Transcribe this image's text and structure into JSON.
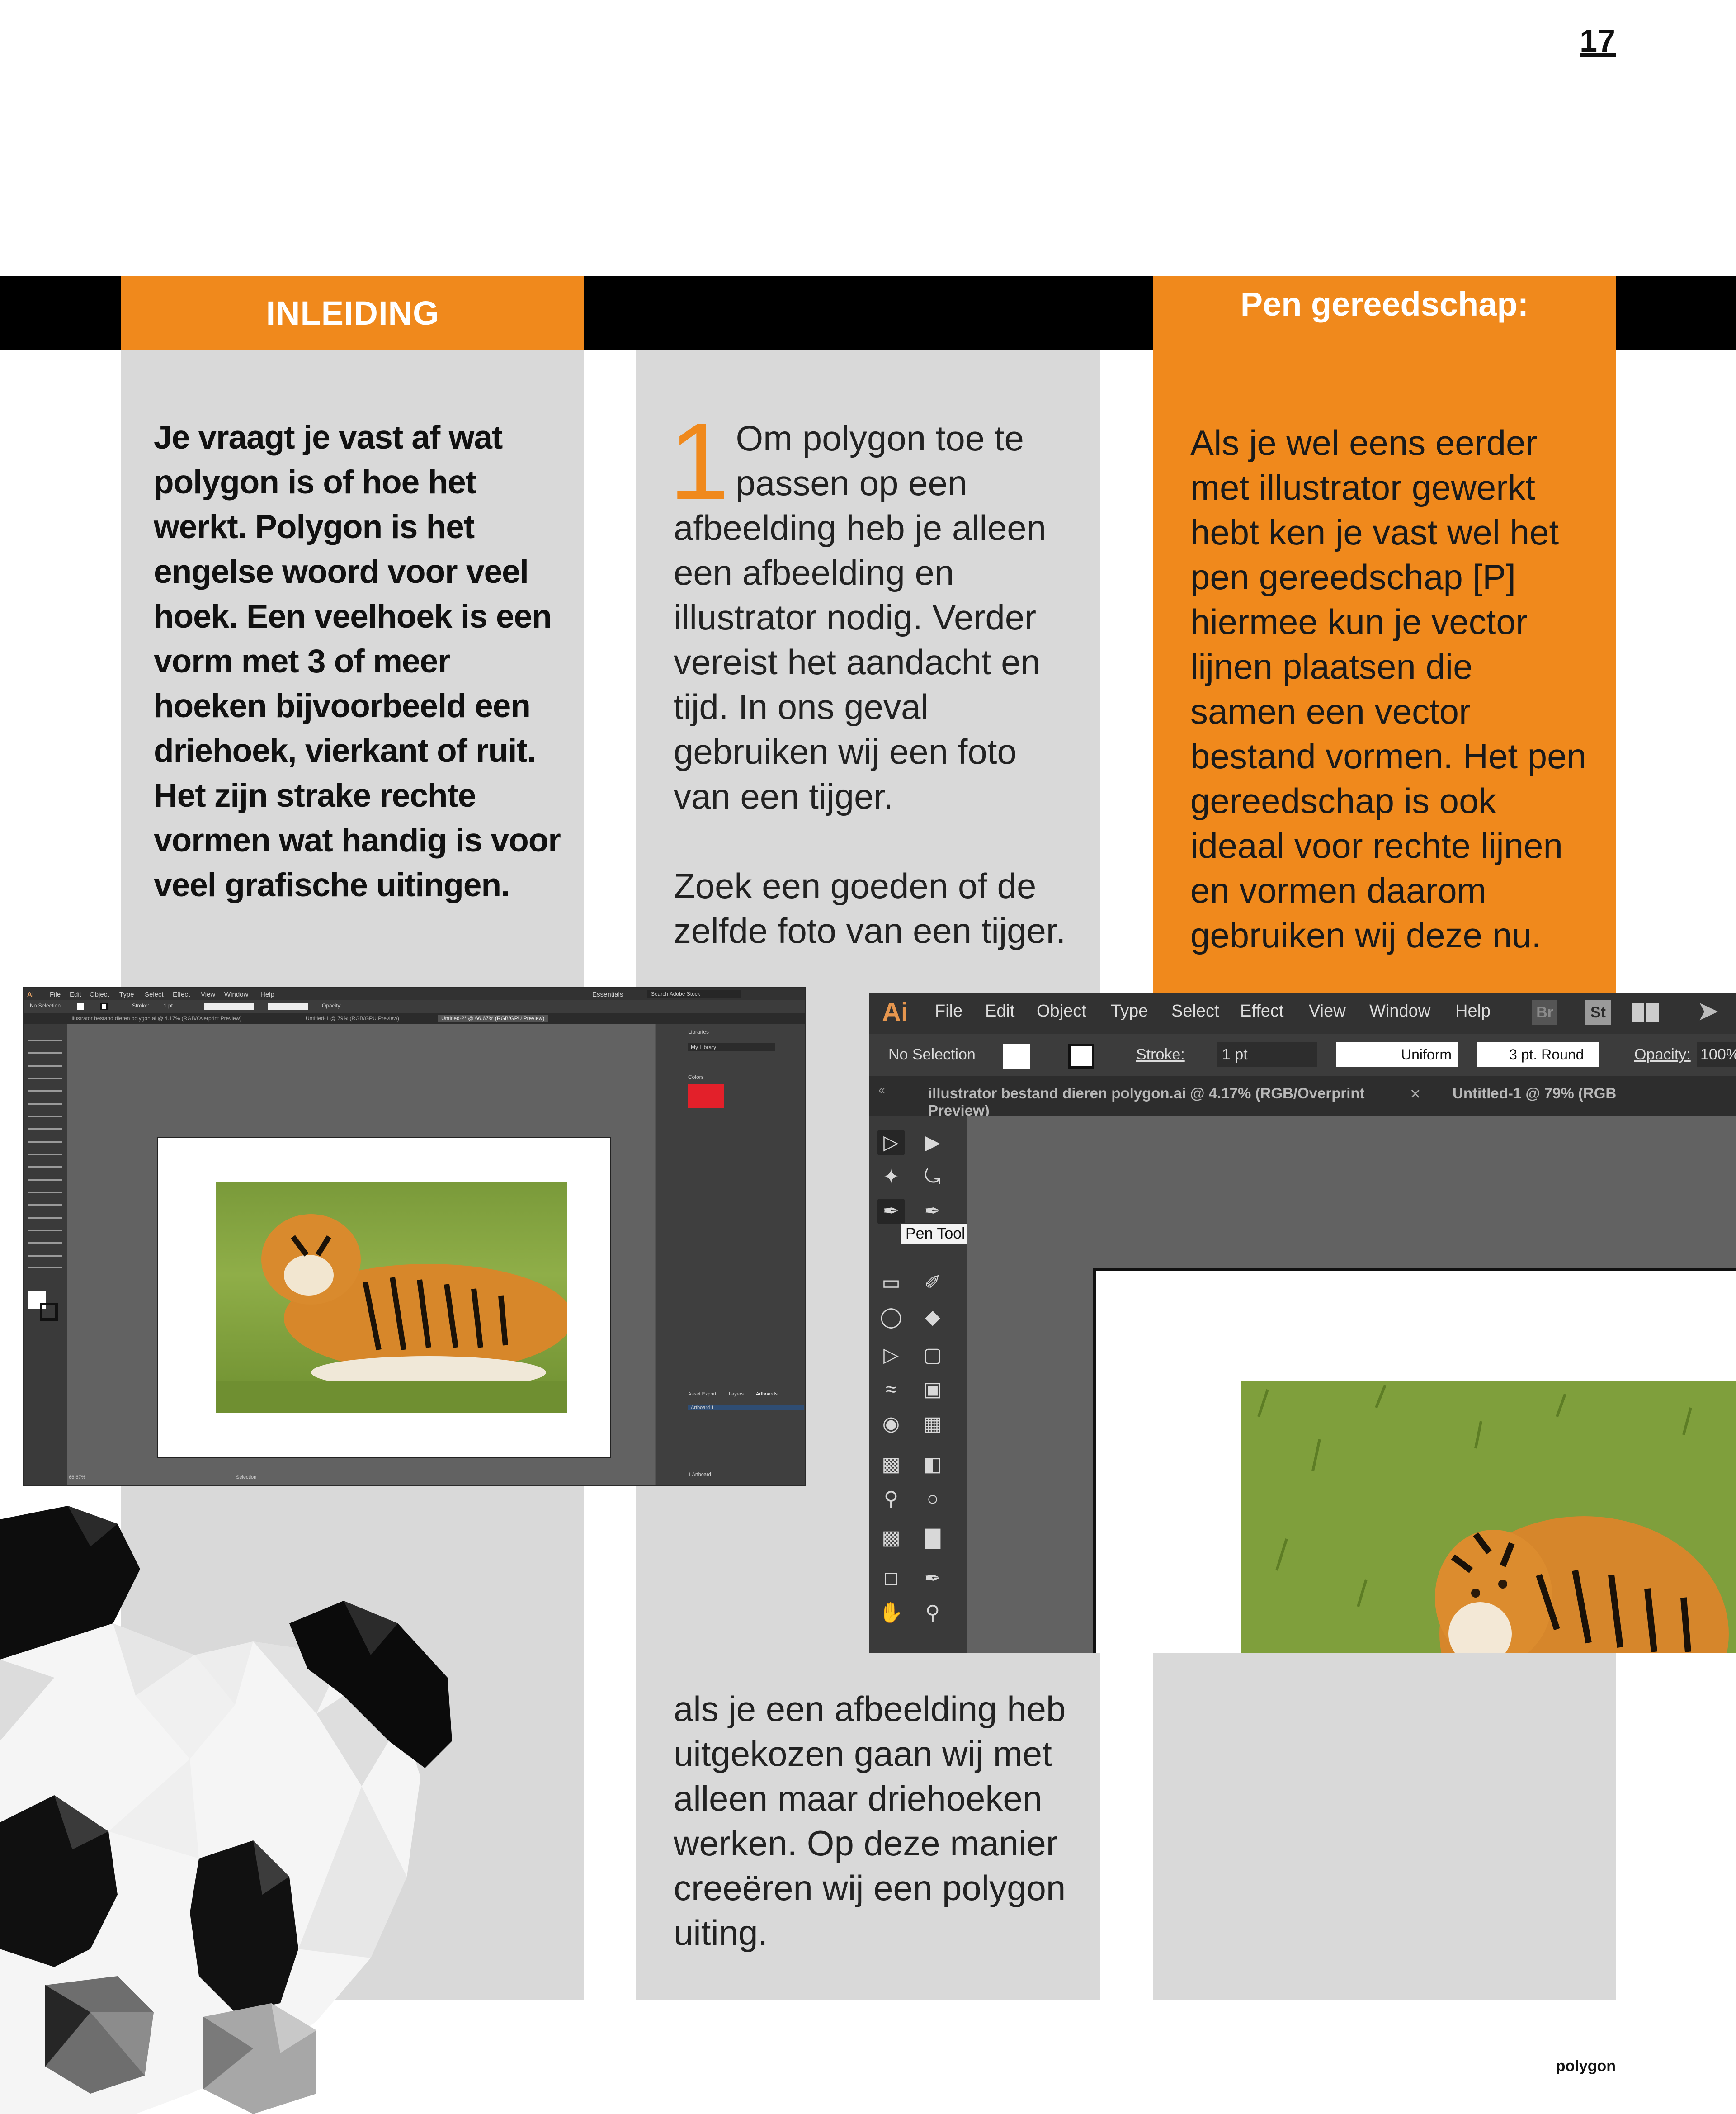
{
  "page": {
    "number": "17",
    "footer": "polygon"
  },
  "intro": {
    "heading": "INLEIDING",
    "text": "Je vraagt je vast af wat polygon is of hoe het werkt. Polygon is het engelse woord voor veel hoek. Een veelhoek is een vorm met 3 of meer hoeken bijvoorbeeld een driehoek, vierkant of ruit. Het zijn strake rechte vormen wat handig is voor veel grafische uitingen."
  },
  "step1": {
    "number": "1",
    "text": "Om polygon toe te passen op een afbeelding heb je alleen een afbeelding en illustrator nodig. Verder vereist het aandacht en tijd. In ons geval gebruiken wij een foto van een tijger.",
    "text2": "Zoek een goeden of de zelfde foto van een tijger.",
    "text3": "als je een afbeelding heb uitgekozen gaan wij met alleen maar driehoeken werken. Op deze manier creeëren wij een polygon uiting."
  },
  "pen": {
    "heading": "Pen gereedschap:",
    "text": "Als je wel eens eerder met illustrator gewerkt hebt ken je vast wel het pen gereedschap [P] hiermee kun je vector lijnen plaatsen die samen een vector bestand vormen. Het pen gereedschap is ook ideaal voor rechte lijnen en vormen daarom gebruiken wij deze nu."
  },
  "illustrator": {
    "logo": "Ai",
    "menu": [
      "File",
      "Edit",
      "Object",
      "Type",
      "Select",
      "Effect",
      "View",
      "Window",
      "Help"
    ],
    "bridge_label": "Br",
    "stock_label": "St",
    "selection_status": "No Selection",
    "stroke_label": "Stroke:",
    "stroke_value": "1 pt",
    "profile": "Uniform",
    "brush": "3 pt. Round",
    "opacity_label": "Opacity:",
    "opacity_value": "100%",
    "tab1": "illustrator bestand dieren polygon.ai @ 4.17% (RGB/Overprint Preview)",
    "tab1_close": "×",
    "tab2": "Untitled-1 @ 79% (RGB",
    "tooltip": "Pen Tool (P)",
    "small": {
      "tab1": "illustrator bestand dieren polygon.ai @ 4.17% (RGB/Overprint Preview)",
      "tab2": "Untitled-1 @ 79% (RGB/GPU Preview)",
      "tab3": "Untitled-2* @ 66.67% (RGB/GPU Preview)",
      "workspace": "Essentials",
      "search": "Search Adobe Stock",
      "panel_libraries": "Libraries",
      "panel_my_library": "My Library",
      "panel_colors": "Colors",
      "panel_tabs": [
        "Asset Export",
        "Layers",
        "Artboards"
      ],
      "artboard_row": "Artboard 1",
      "zoom": "66.67%",
      "status": "Selection",
      "artboard_count": "1 Artboard",
      "accent": "#e3202a"
    }
  },
  "colors": {
    "orange": "#f0891c",
    "grey": "#d9d9d9",
    "black": "#000000"
  }
}
